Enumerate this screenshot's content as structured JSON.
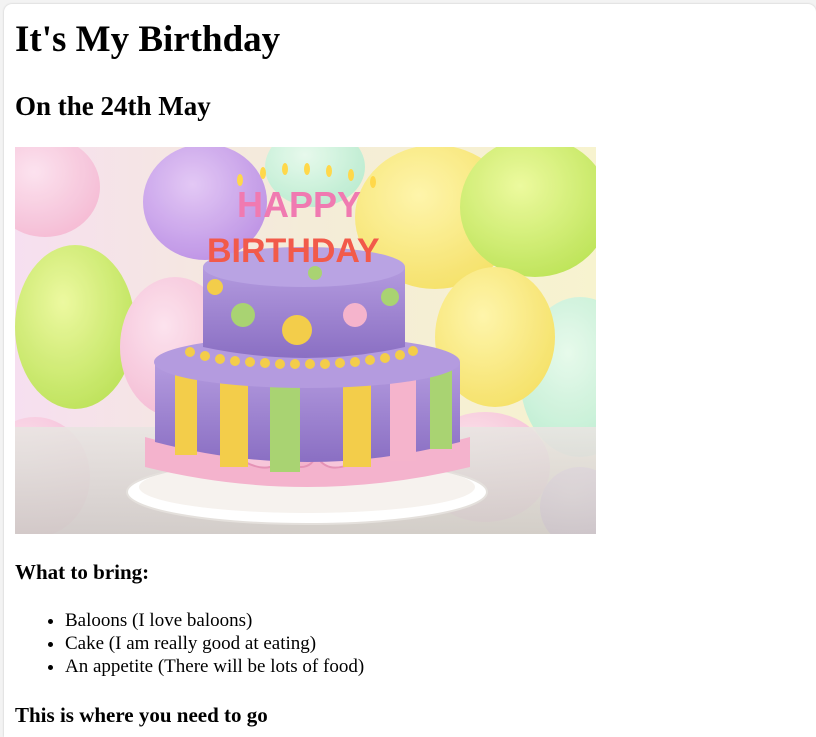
{
  "page": {
    "title": "It's My Birthday",
    "subtitle": "On the 24th May",
    "image": {
      "alt": "HAPPY BIRTHDAY",
      "cake_text_top": "HAPPY",
      "cake_text_bottom": "BIRTHDAY"
    },
    "bring_heading": "What to bring:",
    "bring_items": [
      "Baloons (I love baloons)",
      "Cake (I am really good at eating)",
      "An appetite (There will be lots of food)"
    ],
    "directions_heading": "This is where you need to go"
  },
  "colors": {
    "background": "#ffffff",
    "text": "#000000",
    "cake_purple": "#9b82cf",
    "cake_pink": "#f5b4cc",
    "cake_green": "#a9d372",
    "cake_yellow": "#f3cd4a"
  }
}
